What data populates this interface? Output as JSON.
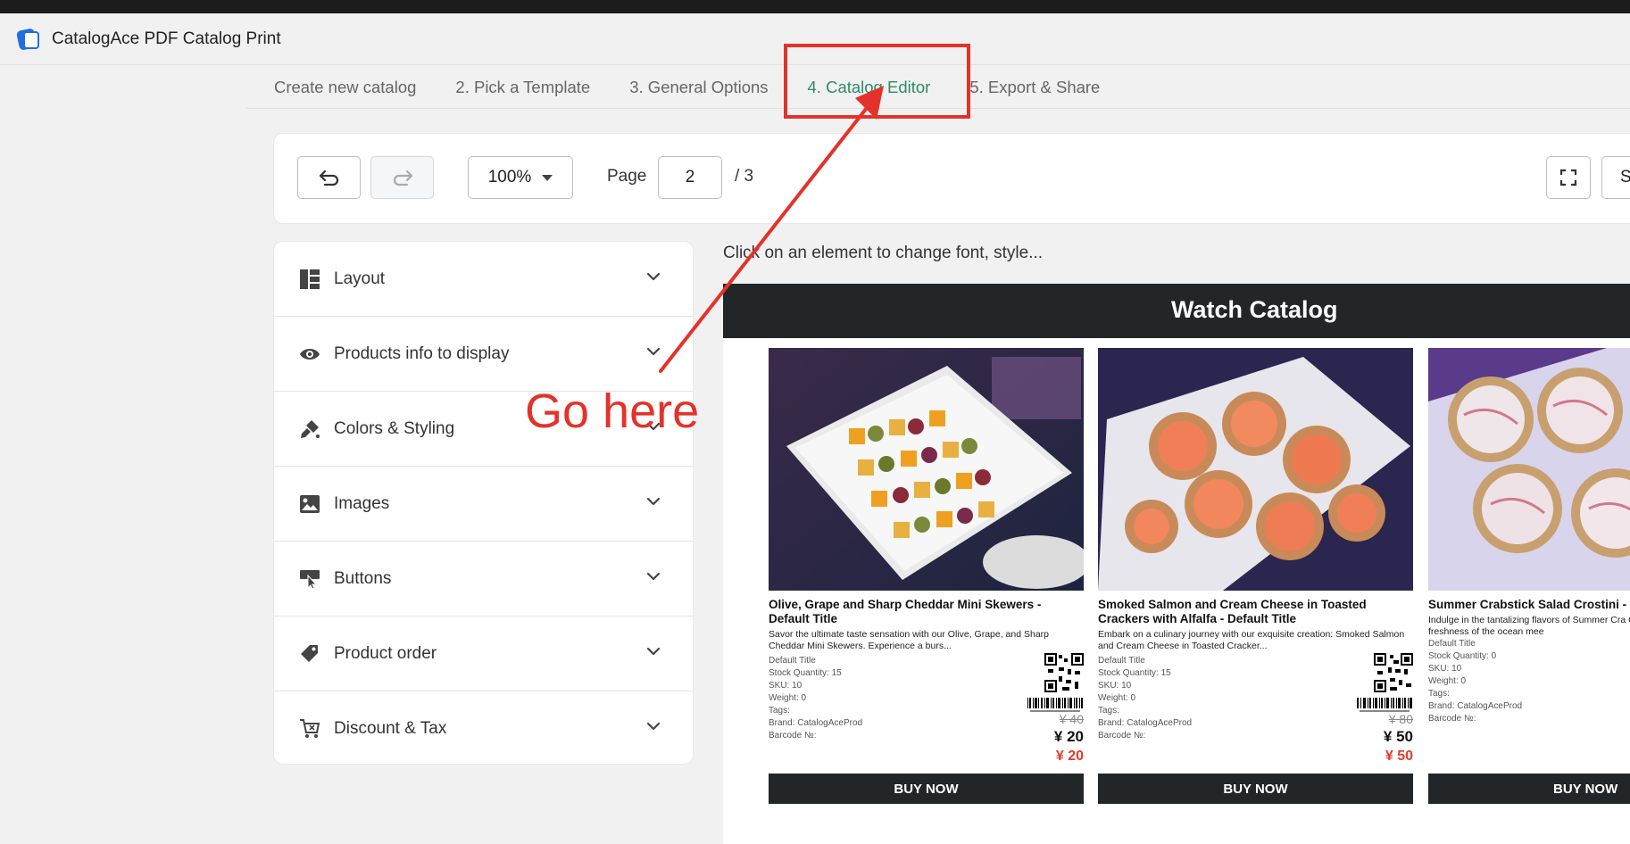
{
  "app": {
    "title": "CatalogAce PDF Catalog Print"
  },
  "tabs": [
    {
      "label": "Create new catalog"
    },
    {
      "label": "2. Pick a Template"
    },
    {
      "label": "3. General Options"
    },
    {
      "label": "4. Catalog Editor"
    },
    {
      "label": "5. Export & Share"
    }
  ],
  "toolbar": {
    "zoom": "100%",
    "page_label": "Page",
    "page_value": "2",
    "page_total": "/ 3",
    "save_label": "S"
  },
  "sidebar": {
    "items": [
      {
        "label": "Layout",
        "icon": "layout-icon"
      },
      {
        "label": "Products info to display",
        "icon": "eye-icon"
      },
      {
        "label": "Colors & Styling",
        "icon": "paint-icon"
      },
      {
        "label": "Images",
        "icon": "image-icon"
      },
      {
        "label": "Buttons",
        "icon": "button-icon"
      },
      {
        "label": "Product order",
        "icon": "tag-icon"
      },
      {
        "label": "Discount & Tax",
        "icon": "cart-icon"
      }
    ]
  },
  "editor": {
    "hint": "Click on an element to change font, style...",
    "catalog_title": "Watch Catalog",
    "products": [
      {
        "name": "Olive, Grape and Sharp Cheddar Mini Skewers - Default Title",
        "desc": "Savor the ultimate taste sensation with our Olive, Grape, and Sharp Cheddar Mini Skewers. Experience a burs...",
        "variant": "Default Title",
        "stock": "Stock Quantity: 15",
        "sku": "SKU: 10",
        "weight": "Weight: 0",
        "tags": "Tags:",
        "brand": "Brand: CatalogAceProd",
        "barcode": "Barcode №:",
        "price_old": "¥ 40",
        "price": "¥ 20",
        "price_sale": "¥ 20",
        "button": "BUY NOW"
      },
      {
        "name": "Smoked Salmon and Cream Cheese in Toasted Crackers with Alfalfa - Default Title",
        "desc": "Embark on a culinary journey with our exquisite creation: Smoked Salmon and Cream Cheese in Toasted Cracker...",
        "variant": "Default Title",
        "stock": "Stock Quantity: 15",
        "sku": "SKU: 10",
        "weight": "Weight: 0",
        "tags": "Tags:",
        "brand": "Brand: CatalogAceProd",
        "barcode": "Barcode №:",
        "price_old": "¥ 80",
        "price": "¥ 50",
        "price_sale": "¥ 50",
        "button": "BUY NOW"
      },
      {
        "name": "Summer Crabstick Salad Crostini -",
        "desc": "Indulge in the tantalizing flavors of Summer Cra Crostini, where the freshness of the ocean mee",
        "variant": "Default Title",
        "stock": "Stock Quantity: 0",
        "sku": "SKU: 10",
        "weight": "Weight: 0",
        "tags": "Tags:",
        "brand": "Brand: CatalogAceProd",
        "barcode": "Barcode №:",
        "button": "BUY NOW"
      }
    ]
  },
  "annotation": {
    "text": "Go here",
    "color": "#e4322a"
  }
}
